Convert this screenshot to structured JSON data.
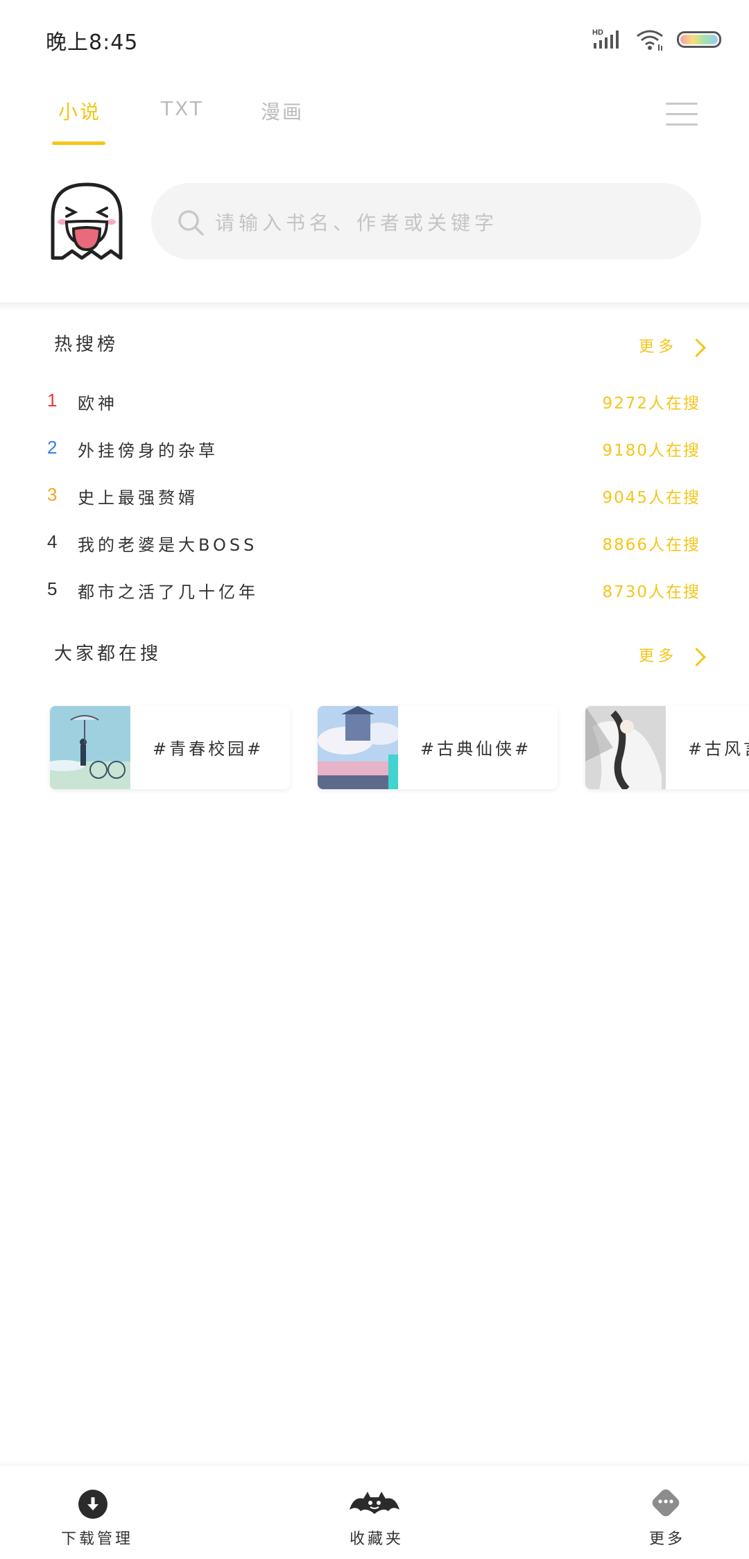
{
  "status_bar": {
    "time": "晚上8:45",
    "network": "HD"
  },
  "tabs": [
    {
      "label": "小说",
      "active": true
    },
    {
      "label": "TXT",
      "active": false
    },
    {
      "label": "漫画",
      "active": false
    }
  ],
  "search": {
    "placeholder": "请输入书名、作者或关键字"
  },
  "hot_search": {
    "title": "热搜榜",
    "more_label": "更多",
    "items": [
      {
        "rank": "1",
        "name": "欧神",
        "count": "9272人在搜",
        "rank_color": "#e53935"
      },
      {
        "rank": "2",
        "name": "外挂傍身的杂草",
        "count": "9180人在搜",
        "rank_color": "#3b7ddd"
      },
      {
        "rank": "3",
        "name": "史上最强赘婿",
        "count": "9045人在搜",
        "rank_color": "#f5a623"
      },
      {
        "rank": "4",
        "name": "我的老婆是大BOSS",
        "count": "8866人在搜",
        "rank_color": "#333333"
      },
      {
        "rank": "5",
        "name": "都市之活了几十亿年",
        "count": "8730人在搜",
        "rank_color": "#333333"
      }
    ]
  },
  "everyone_search": {
    "title": "大家都在搜",
    "more_label": "更多",
    "tags": [
      {
        "label": "#青春校园#",
        "thumb": "school-bicycle-thumbnail"
      },
      {
        "label": "#古典仙侠#",
        "thumb": "fantasy-castle-thumbnail"
      },
      {
        "label": "#古风言",
        "thumb": "ancient-style-figure-thumbnail"
      }
    ]
  },
  "bottom_nav": [
    {
      "label": "下载管理",
      "icon": "download-icon"
    },
    {
      "label": "收藏夹",
      "icon": "bat-icon"
    },
    {
      "label": "更多",
      "icon": "more-icon"
    }
  ],
  "colors": {
    "accent": "#f5c518",
    "search_bg": "#f4f4f4"
  }
}
